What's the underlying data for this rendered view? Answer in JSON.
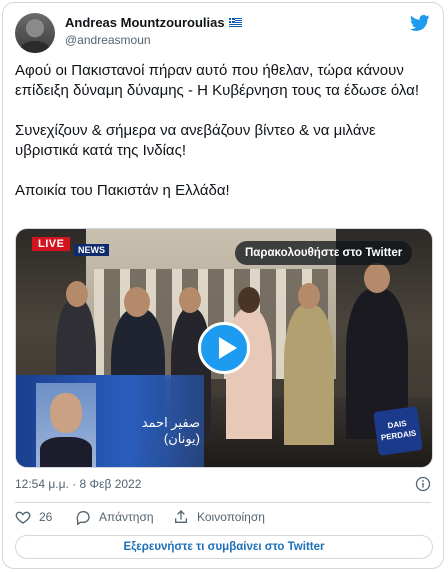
{
  "author": {
    "name": "Andreas Mountzouroulias",
    "handle": "@andreasmoun",
    "flag_icon": "greece-flag-icon"
  },
  "brand_icon": "twitter-bird-icon",
  "brand_color": "#1d9bf0",
  "tweet": {
    "paragraphs": [
      "Αφού οι Πακιστανοί πήραν αυτό που ήθελαν, τώρα κάνουν επίδειξη δύναμη δύναμης - Η Κυβέρνηση τους τα έδωσε όλα!",
      "Συνεχίζουν & σήμερα να ανεβάζουν βίντεο & να μιλάνε υβριστικά κατά της Ινδίας!",
      "Αποικία του Πακιστάν η Ελλάδα!"
    ]
  },
  "video": {
    "watch_label": "Παρακολουθήστε στο Twitter",
    "live_badge": "LIVE",
    "news_badge": "NEWS",
    "overlay_caption": "صفیر احمد (یونان)",
    "logo_text": "DAIS PERDAIS"
  },
  "meta": {
    "timestamp": "12:54 μ.μ. · 8 Φεβ 2022"
  },
  "actions": {
    "like_count": "26",
    "reply_label": "Απάντηση",
    "share_label": "Κοινοποίηση"
  },
  "explore_label": "Εξερευνήστε τι συμβαίνει στο Twitter"
}
